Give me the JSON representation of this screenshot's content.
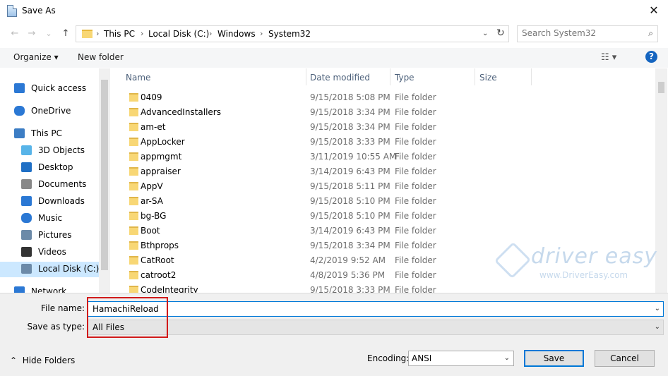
{
  "window": {
    "title": "Save As",
    "close_glyph": "✕"
  },
  "nav_buttons": {
    "back": "←",
    "forward": "→",
    "recent": "⌄",
    "up": "↑"
  },
  "address": {
    "crumbs": [
      "This PC",
      "Local Disk (C:)",
      "Windows",
      "System32"
    ],
    "separator": "›"
  },
  "search": {
    "placeholder": "Search System32"
  },
  "toolbar": {
    "organize_label": "Organize ▾",
    "new_folder_label": "New folder",
    "help_glyph": "?"
  },
  "nav_pane": {
    "items": [
      {
        "label": "Quick access",
        "icon": "star-icon",
        "color": "#2b78d4"
      },
      {
        "label": "OneDrive",
        "icon": "cloud-icon",
        "color": "#2b78d4"
      },
      {
        "label": "This PC",
        "icon": "computer-icon",
        "color": "#3c7dc4"
      },
      {
        "label": "3D Objects",
        "icon": "cube-icon",
        "color": "#58b4e8"
      },
      {
        "label": "Desktop",
        "icon": "desktop-icon",
        "color": "#1f6fc5"
      },
      {
        "label": "Documents",
        "icon": "document-icon",
        "color": "#888888"
      },
      {
        "label": "Downloads",
        "icon": "download-icon",
        "color": "#2b78d4"
      },
      {
        "label": "Music",
        "icon": "music-icon",
        "color": "#2b78d4"
      },
      {
        "label": "Pictures",
        "icon": "picture-icon",
        "color": "#6c8aa8"
      },
      {
        "label": "Videos",
        "icon": "video-icon",
        "color": "#333333"
      },
      {
        "label": "Local Disk (C:)",
        "icon": "drive-icon",
        "color": "#6c8aa8"
      },
      {
        "label": "Network",
        "icon": "network-icon",
        "color": "#2b78d4"
      }
    ]
  },
  "columns": [
    "Name",
    "Date modified",
    "Type",
    "Size"
  ],
  "files": [
    {
      "name": "0409",
      "date": "9/15/2018 5:08 PM",
      "type": "File folder"
    },
    {
      "name": "AdvancedInstallers",
      "date": "9/15/2018 3:34 PM",
      "type": "File folder"
    },
    {
      "name": "am-et",
      "date": "9/15/2018 3:34 PM",
      "type": "File folder"
    },
    {
      "name": "AppLocker",
      "date": "9/15/2018 3:33 PM",
      "type": "File folder"
    },
    {
      "name": "appmgmt",
      "date": "3/11/2019 10:55 AM",
      "type": "File folder"
    },
    {
      "name": "appraiser",
      "date": "3/14/2019 6:43 PM",
      "type": "File folder"
    },
    {
      "name": "AppV",
      "date": "9/15/2018 5:11 PM",
      "type": "File folder"
    },
    {
      "name": "ar-SA",
      "date": "9/15/2018 5:10 PM",
      "type": "File folder"
    },
    {
      "name": "bg-BG",
      "date": "9/15/2018 5:10 PM",
      "type": "File folder"
    },
    {
      "name": "Boot",
      "date": "3/14/2019 6:43 PM",
      "type": "File folder"
    },
    {
      "name": "Bthprops",
      "date": "9/15/2018 3:34 PM",
      "type": "File folder"
    },
    {
      "name": "CatRoot",
      "date": "4/2/2019 9:52 AM",
      "type": "File folder"
    },
    {
      "name": "catroot2",
      "date": "4/8/2019 5:36 PM",
      "type": "File folder"
    },
    {
      "name": "CodeIntegrity",
      "date": "9/15/2018 3:33 PM",
      "type": "File folder"
    }
  ],
  "watermark": {
    "brand": "driver easy",
    "url": "www.DriverEasy.com"
  },
  "form": {
    "file_name_label": "File name:",
    "file_name_value": "HamachiReload",
    "save_type_label": "Save as type:",
    "save_type_value": "All Files",
    "hide_folders_label": "Hide Folders",
    "encoding_label": "Encoding:",
    "encoding_value": "ANSI",
    "save_label": "Save",
    "cancel_label": "Cancel"
  },
  "colors": {
    "accent": "#0078d7",
    "highlight": "#d11a1a",
    "folder": "#f8d775",
    "selected_nav": "#cce8ff"
  }
}
